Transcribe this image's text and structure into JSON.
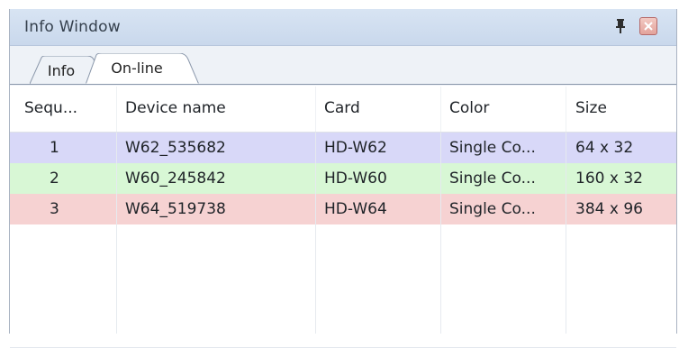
{
  "window": {
    "title": "Info Window"
  },
  "tabs": [
    {
      "label": "Info",
      "active": false
    },
    {
      "label": "On-line",
      "active": true
    }
  ],
  "table": {
    "headers": [
      "Sequ...",
      "Device name",
      "Card",
      "Color",
      "Size"
    ],
    "rows": [
      {
        "seq": "1",
        "device_name": "W62_535682",
        "card": "HD-W62",
        "color": "Single Co...",
        "size": "64 x 32",
        "bg": "#d8d8f8"
      },
      {
        "seq": "2",
        "device_name": "W60_245842",
        "card": "HD-W60",
        "color": "Single Co...",
        "size": "160 x 32",
        "bg": "#d8f7d5"
      },
      {
        "seq": "3",
        "device_name": "W64_519738",
        "card": "HD-W64",
        "color": "Single Co...",
        "size": "384 x 96",
        "bg": "#f6d2d2"
      }
    ]
  },
  "icons": {
    "pin": "pin-icon",
    "close": "close-icon"
  },
  "colors": {
    "titlebar": "#d8e4f3",
    "row1": "#d8d8f8",
    "row2": "#d8f7d5",
    "row3": "#f6d2d2",
    "grid_line": "#e4e8ee"
  }
}
